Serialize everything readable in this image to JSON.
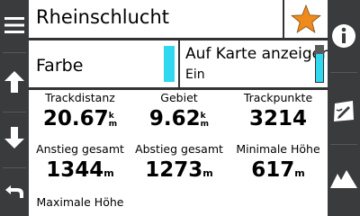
{
  "header": {
    "title": "Rheinschlucht"
  },
  "options": {
    "color_label": "Farbe",
    "color_swatch": "#2fd8ee",
    "map_label": "Auf Karte anzeigen",
    "map_value": "Ein"
  },
  "stats": [
    {
      "label": "Trackdistanz",
      "value": "20.67",
      "unit_top": "k",
      "unit_bottom": "m"
    },
    {
      "label": "Gebiet",
      "value": "9.62",
      "unit_top": "k",
      "unit_bottom": "m"
    },
    {
      "label": "Trackpunkte",
      "value": "3214"
    },
    {
      "label": "Anstieg gesamt",
      "value": "1344",
      "unit": "m"
    },
    {
      "label": "Abstieg gesamt",
      "value": "1273",
      "unit": "m"
    },
    {
      "label": "Minimale Höhe",
      "value": "617",
      "unit": "m"
    },
    {
      "label": "Maximale Höhe"
    }
  ],
  "left_toolbar": {
    "icons": [
      "menu-icon",
      "arrow-up-icon",
      "arrow-down-icon",
      "back-icon"
    ]
  },
  "right_toolbar": {
    "icons": [
      "info-icon",
      "map-edit-icon",
      "elevation-profile-icon"
    ]
  },
  "colors": {
    "accent_cyan": "#2fd8ee",
    "star_orange": "#f08a1c",
    "toolbar_bg": "#3a3b3d"
  }
}
